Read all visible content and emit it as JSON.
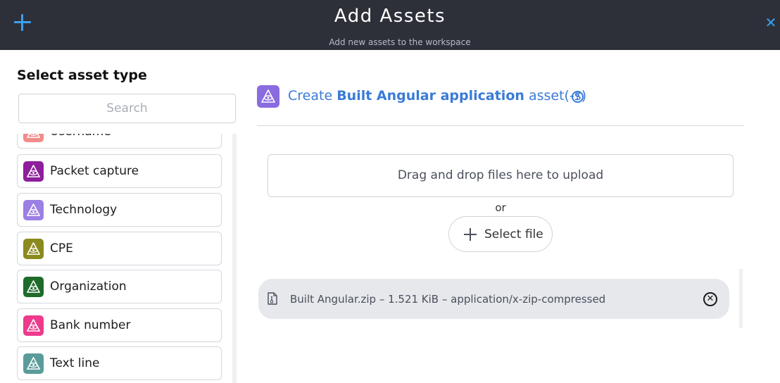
{
  "header": {
    "title": "Add Assets",
    "subtitle": "Add new assets to the workspace",
    "add_icon": "plus-icon",
    "close_icon": "close-icon",
    "close_glyph": "✕",
    "accent_color": "#3aa0f2",
    "background": "#2d3039"
  },
  "sidebar": {
    "heading": "Select asset type",
    "search_placeholder": "Search",
    "items": [
      {
        "label": "Username",
        "color": "#f28b8b",
        "icon": "eye-pyramid-icon"
      },
      {
        "label": "Packet capture",
        "color": "#8e1e9c",
        "icon": "eye-pyramid-icon"
      },
      {
        "label": "Technology",
        "color": "#9b7fe3",
        "icon": "eye-pyramid-icon"
      },
      {
        "label": "CPE",
        "color": "#8a8a1e",
        "icon": "eye-pyramid-icon"
      },
      {
        "label": "Organization",
        "color": "#1e6b2a",
        "icon": "eye-pyramid-icon"
      },
      {
        "label": "Bank number",
        "color": "#ee3a8c",
        "icon": "eye-pyramid-icon"
      },
      {
        "label": "Text line",
        "color": "#5a9c9a",
        "icon": "eye-pyramid-icon"
      }
    ]
  },
  "main": {
    "create_prefix": "Create",
    "create_type": "Built Angular application",
    "create_suffix": "asset(-s)",
    "create_icon_color": "#8a6be0",
    "help_glyph": "?",
    "dropzone_text": "Drag and drop files here to upload",
    "or_text": "or",
    "select_file_label": "Select file",
    "files": [
      {
        "name": "Built Angular.zip",
        "size": "1.521 KiB",
        "mime": "application/x-zip-compressed",
        "display": "Built Angular.zip  –  1.521 KiB  –  application/x-zip-compressed"
      }
    ],
    "remove_glyph": "✕"
  }
}
